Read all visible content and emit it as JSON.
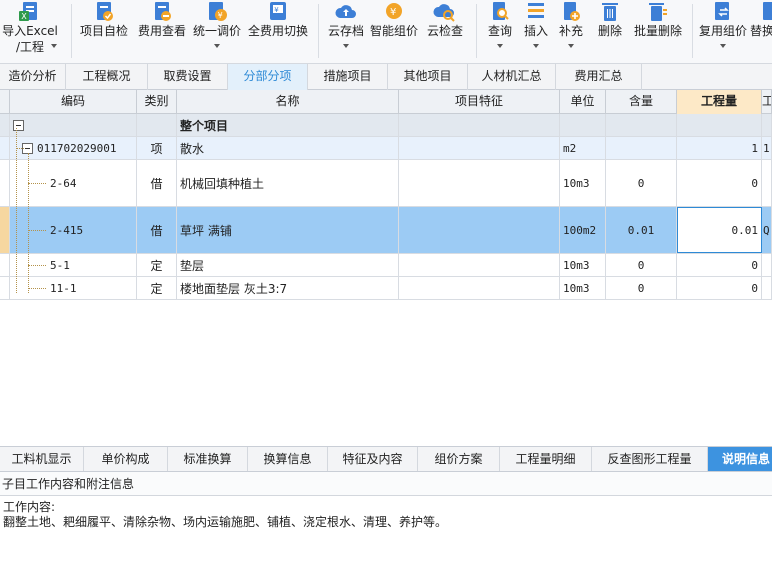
{
  "toolbar": {
    "import_line1": "导入Excel",
    "import_line2": "/工程",
    "self_check": "项目自检",
    "fee_view": "费用查看",
    "unified_adjust": "统一调价",
    "all_fee_switch": "全费用切换",
    "cloud_save": "云存档",
    "smart_price": "智能组价",
    "cloud_check": "云检查",
    "query": "查询",
    "insert": "插入",
    "supplement": "补充",
    "delete": "删除",
    "batch_delete": "批量删除",
    "reuse_price": "复用组价",
    "replace": "替换"
  },
  "tabs": [
    "造价分析",
    "工程概况",
    "取费设置",
    "分部分项",
    "措施项目",
    "其他项目",
    "人材机汇总",
    "费用汇总"
  ],
  "active_tab": "分部分项",
  "grid": {
    "headers": {
      "code": "编码",
      "type": "类别",
      "name": "名称",
      "feature": "项目特征",
      "unit": "单位",
      "content_qty": "含量",
      "quantity": "工程量",
      "extra": "工"
    },
    "group_row": {
      "name": "整个项目"
    },
    "rows": [
      {
        "code": "011702029001",
        "type": "项",
        "name": "散水",
        "unit": "m2",
        "content_qty": "",
        "quantity": "1",
        "extra": "1"
      },
      {
        "code": "2-64",
        "type": "借",
        "name": "机械回填种植土",
        "unit": "10m3",
        "content_qty": "0",
        "quantity": "0",
        "extra": ""
      },
      {
        "code": "2-415",
        "type": "借",
        "name": "草坪 满铺",
        "unit": "100m2",
        "content_qty": "0.01",
        "quantity": "0.01",
        "extra": "Q"
      },
      {
        "code": "5-1",
        "type": "定",
        "name": "垫层",
        "unit": "10m3",
        "content_qty": "0",
        "quantity": "0",
        "extra": ""
      },
      {
        "code": "11-1",
        "type": "定",
        "name": "楼地面垫层 灰土3:7",
        "unit": "10m3",
        "content_qty": "0",
        "quantity": "0",
        "extra": ""
      }
    ]
  },
  "bottom_tabs": [
    "工料机显示",
    "单价构成",
    "标准换算",
    "换算信息",
    "特征及内容",
    "组价方案",
    "工程量明细",
    "反查图形工程量",
    "说明信息"
  ],
  "active_bottom_tab": "说明信息",
  "panel": {
    "title": "子目工作内容和附注信息",
    "content_label": "工作内容:",
    "content_text": "翻整土地、耙细履平、清除杂物、场内运输施肥、铺植、浇定根水、清理、养护等。"
  }
}
